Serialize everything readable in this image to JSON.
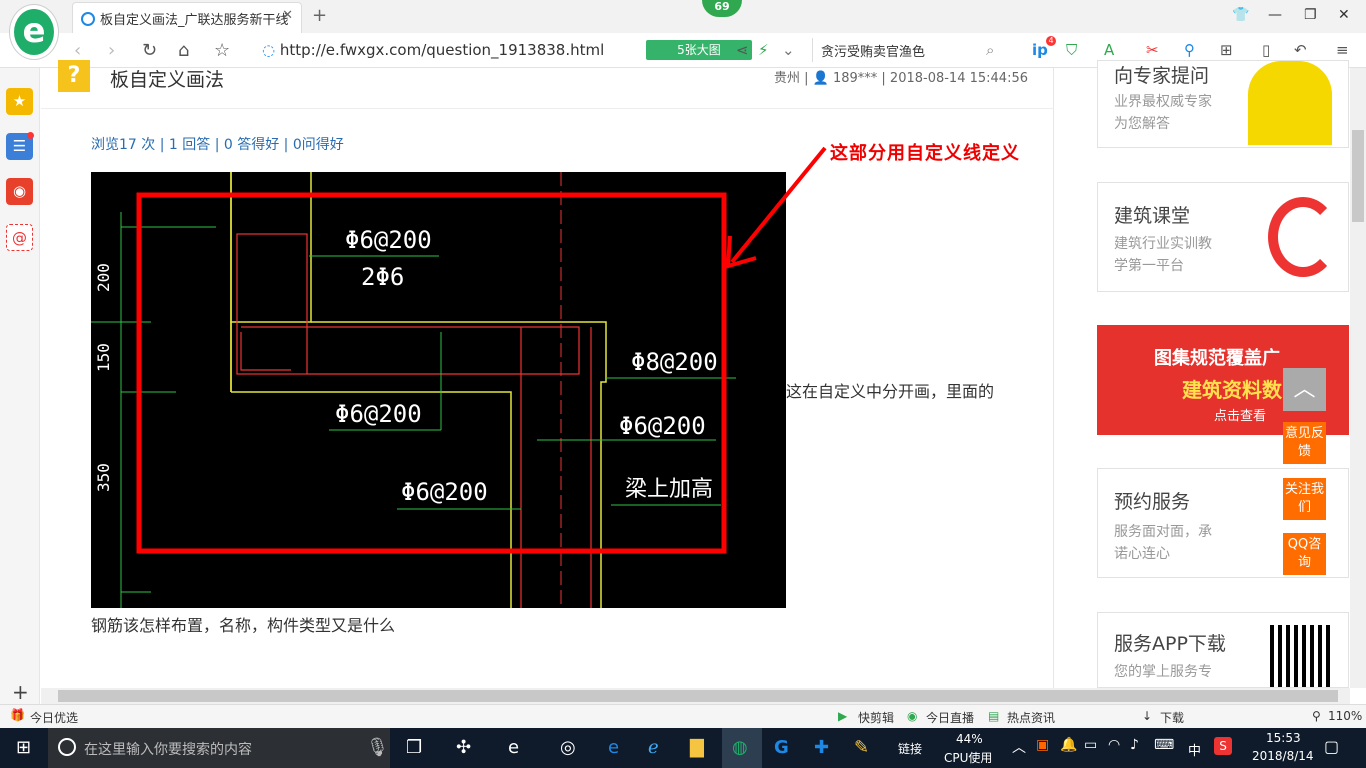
{
  "browser": {
    "logo_letter": "e",
    "tab_title": "板自定义画法_广联达服务新干线",
    "tab_close": "✕",
    "new_tab": "+",
    "badge": "69",
    "url_prefix": "http://e.",
    "url_domain": "fwxgx.com",
    "url_path": "/question_1913838.html",
    "big_pic_button": "5张大图",
    "search_text": "贪污受贿卖官渔色",
    "toolbar_badge": "4"
  },
  "question": {
    "title": "板自定义画法",
    "meta": "贵州 | 👤 189*** | 2018-08-14 15:44:56",
    "stats": "浏览17 次 | 1 回答 | 0 答得好 | 0问得好",
    "annotation": "这部分用自定义线定义",
    "paragraph_1": "这在自定义中分开画，里面的",
    "paragraph_2": "钢筋该怎样布置，名称，构件类型又是什么"
  },
  "cad": {
    "labels": [
      "Φ6@200",
      "2Φ6",
      "Φ8@200",
      "Φ6@200",
      "Φ6@200",
      "Φ6@200",
      "梁上加高"
    ],
    "dims": [
      "200",
      "150",
      "350"
    ]
  },
  "sidebar_cards": [
    {
      "title": "向专家提问",
      "lines": [
        "业界最权威专家",
        "为您解答"
      ]
    },
    {
      "title": "建筑课堂",
      "lines": [
        "建筑行业实训教",
        "学第一平台"
      ]
    },
    {
      "title": "图集规范覆盖广",
      "lines": [
        "建筑资料数",
        "点击查看"
      ]
    },
    {
      "title": "预约服务",
      "lines": [
        "服务面对面，承",
        "诺心连心"
      ]
    },
    {
      "title": "服务APP下载",
      "lines": [
        "您的掌上服务专"
      ]
    }
  ],
  "float_buttons": [
    "意见反馈",
    "关注我们",
    "QQ咨询"
  ],
  "status_bar": {
    "left": "今日优选",
    "items": [
      "快剪辑",
      "今日直播",
      "热点资讯"
    ],
    "download": "下载",
    "zoom": "110%"
  },
  "taskbar": {
    "search_placeholder": "在这里输入你要搜索的内容",
    "link_label": "链接",
    "cpu_percent": "44%",
    "cpu_label": "CPU使用",
    "ime": "中",
    "time": "15:53",
    "date": "2018/8/14"
  },
  "colors": {
    "accent": "#1fae6a",
    "annotation_red": "#e00000",
    "float_orange": "#ff6d00"
  }
}
